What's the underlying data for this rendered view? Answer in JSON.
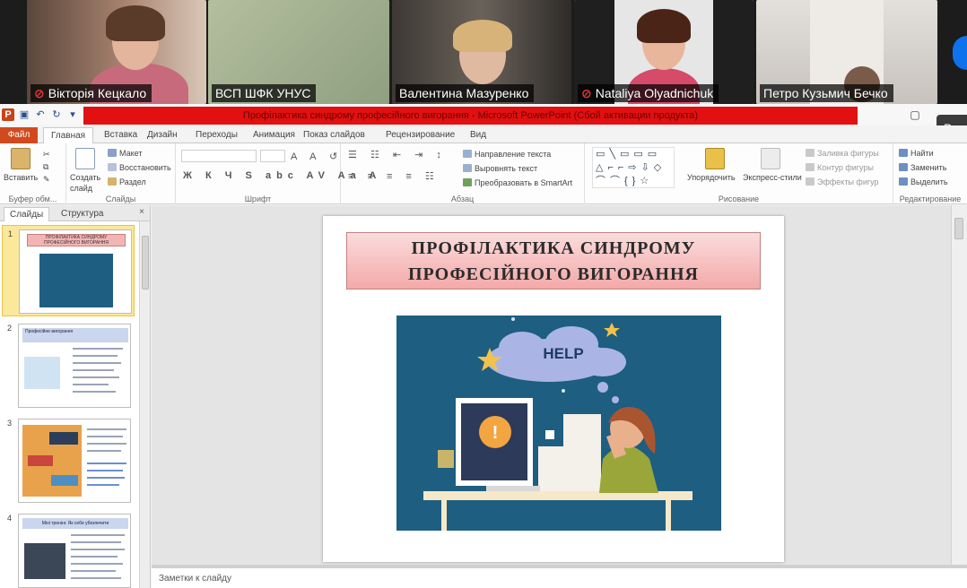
{
  "participants": [
    {
      "name": "Вікторія Кецкало",
      "muted": true
    },
    {
      "name": "ВСП ШФК УНУС",
      "muted": false
    },
    {
      "name": "Валентина Мазуренко",
      "muted": false
    },
    {
      "name": "Nataliya Olyadnichuk",
      "muted": true
    },
    {
      "name": "Петро Кузьмич Бечко",
      "muted": false
    }
  ],
  "mic_muted_symbol": "🎤̸",
  "window_title": "Профілактика синдрому професійного вигорання - Microsoft PowerPoint (Сбой активации продукта)",
  "tooltip": "Вхо",
  "tabs": [
    "Файл",
    "Главная",
    "Вставка",
    "Дизайн",
    "Переходы",
    "Анимация",
    "Показ слайдов",
    "Рецензирование",
    "Вид"
  ],
  "ribbon": {
    "clipboard": {
      "paste": "Вставить",
      "label": "Буфер обм..."
    },
    "slides": {
      "new_slide": "Создать слайд",
      "layout": "Макет",
      "reset": "Восстановить",
      "section": "Раздел",
      "label": "Слайды"
    },
    "font": {
      "label": "Шрифт"
    },
    "paragraph": {
      "text_direction": "Направление текста",
      "align_text": "Выровнять текст",
      "smartart": "Преобразовать в SmartArt",
      "label": "Абзац"
    },
    "drawing": {
      "arrange": "Упорядочить",
      "quick_styles": "Экспресс-стили",
      "label": "Рисование",
      "shape_fill": "Заливка фигуры",
      "shape_outline": "Контур фигуры",
      "shape_effects": "Эффекты фигур"
    },
    "editing": {
      "find": "Найти",
      "replace": "Заменить",
      "select": "Выделить",
      "label": "Редактирование"
    }
  },
  "panel_tabs": [
    "Слайды",
    "Структура"
  ],
  "panel_close": "×",
  "thumbnails": [
    {
      "num": "1",
      "title": "ПРОФІЛАКТИКА СИНДРОМУ ПРОФЕСІЙНОГО ВИГОРАННЯ"
    },
    {
      "num": "2",
      "title": "Професійне вигорання"
    },
    {
      "num": "3",
      "title": ""
    },
    {
      "num": "4",
      "title": "Міні тренінг. Як себе убезпечити"
    }
  ],
  "slide": {
    "title_line1": "ПРОФІЛАКТИКА СИНДРОМУ",
    "title_line2": "ПРОФЕСІЙНОГО ВИГОРАННЯ",
    "bubble": "HELP",
    "alert": "!"
  },
  "notes_placeholder": "Заметки к слайду"
}
